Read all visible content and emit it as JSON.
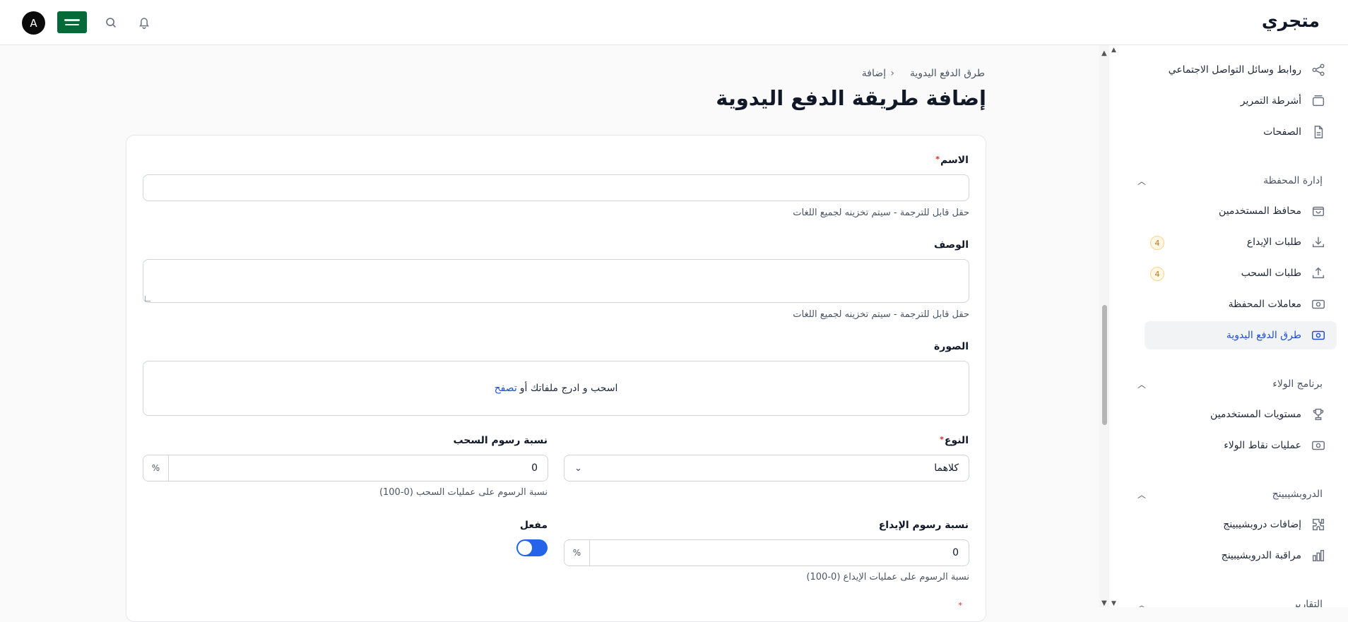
{
  "header": {
    "brand": "متجري",
    "avatar_initial": "A",
    "icons": [
      "search-icon",
      "bell-icon"
    ]
  },
  "sidebar": {
    "items": [
      {
        "label": "روابط وسائل التواصل الاجتماعي",
        "icon": "share-icon"
      },
      {
        "label": "أشرطة التمرير",
        "icon": "slides-icon"
      },
      {
        "label": "الصفحات",
        "icon": "document-icon"
      }
    ],
    "groups": [
      {
        "label": "إدارة المحفظة",
        "items": [
          {
            "label": "محافظ المستخدمين",
            "icon": "wallet-icon"
          },
          {
            "label": "طلبات الإيداع",
            "icon": "download-icon",
            "badge": "4"
          },
          {
            "label": "طلبات السحب",
            "icon": "upload-icon",
            "badge": "4"
          },
          {
            "label": "معاملات المحفظة",
            "icon": "money-icon"
          },
          {
            "label": "طرق الدفع اليدوية",
            "icon": "money-icon",
            "active": true
          }
        ]
      },
      {
        "label": "برنامج الولاء",
        "items": [
          {
            "label": "مستويات المستخدمين",
            "icon": "trophy-icon"
          },
          {
            "label": "عمليات نقاط الولاء",
            "icon": "money-icon"
          }
        ]
      },
      {
        "label": "الدروبشيبينج",
        "items": [
          {
            "label": "إضافات دروبشيبينج",
            "icon": "puzzle-icon"
          },
          {
            "label": "مراقبة الدروبشيبينج",
            "icon": "chart-icon"
          }
        ]
      },
      {
        "label": "التقارير",
        "items": []
      }
    ]
  },
  "breadcrumb": {
    "parent": "طرق الدفع اليدوية",
    "current": "إضافة"
  },
  "page": {
    "title": "إضافة طريقة الدفع اليدوية"
  },
  "form": {
    "name": {
      "label": "الاسم",
      "value": "",
      "hint": "حقل قابل للترجمة - سيتم تخزينه لجميع اللغات"
    },
    "description": {
      "label": "الوصف",
      "value": "",
      "hint": "حقل قابل للترجمة - سيتم تخزينه لجميع اللغات"
    },
    "image": {
      "label": "الصورة",
      "drop_text": "اسحب و ادرج ملفاتك أو",
      "browse_text": "تصفح"
    },
    "type": {
      "label": "النوع",
      "value": "كلاهما"
    },
    "withdraw_fee": {
      "label": "نسبة رسوم السحب",
      "value": "0",
      "unit": "%",
      "hint": "نسبة الرسوم على عمليات السحب (0-100)"
    },
    "deposit_fee": {
      "label": "نسبة رسوم الإيداع",
      "value": "0",
      "unit": "%",
      "hint": "نسبة الرسوم على عمليات الإيداع (0-100)"
    },
    "enabled": {
      "label": "مفعل",
      "value": true
    }
  },
  "colors": {
    "accent": "#2563eb",
    "active_link": "#1e4fd0",
    "required": "#dc2626",
    "flag_green": "#046a38"
  }
}
